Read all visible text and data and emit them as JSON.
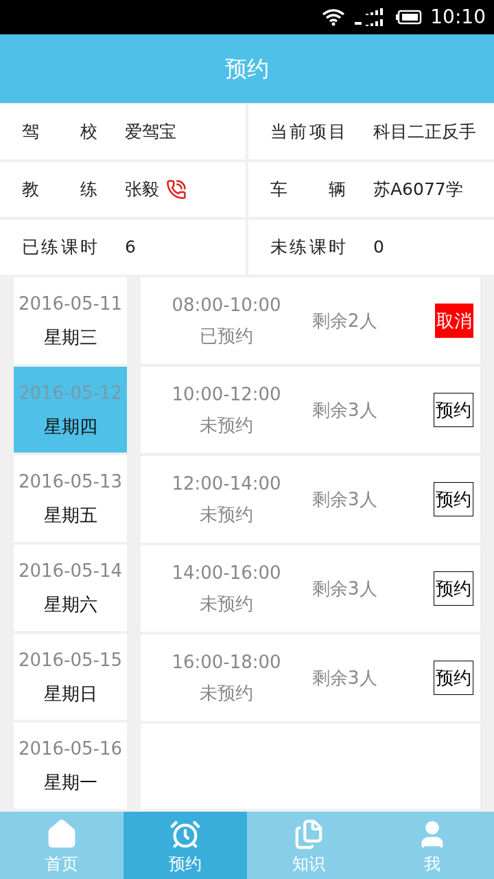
{
  "status_bar": {
    "time": "10:10"
  },
  "header": {
    "title": "预约"
  },
  "info": [
    {
      "label": "驾 校",
      "value": "爱驾宝",
      "phone": false
    },
    {
      "label": "当前项目",
      "value": "科目二正反手",
      "phone": false
    },
    {
      "label": "教 练",
      "value": "张毅",
      "phone": true
    },
    {
      "label": "车 辆",
      "value": "苏A6077学",
      "phone": false
    },
    {
      "label": "已练课时",
      "value": "6",
      "phone": false
    },
    {
      "label": "未练课时",
      "value": "0",
      "phone": false
    }
  ],
  "dates": [
    {
      "date": "2016-05-11",
      "weekday": "星期三",
      "selected": false
    },
    {
      "date": "2016-05-12",
      "weekday": "星期四",
      "selected": true
    },
    {
      "date": "2016-05-13",
      "weekday": "星期五",
      "selected": false
    },
    {
      "date": "2016-05-14",
      "weekday": "星期六",
      "selected": false
    },
    {
      "date": "2016-05-15",
      "weekday": "星期日",
      "selected": false
    },
    {
      "date": "2016-05-16",
      "weekday": "星期一",
      "selected": false
    }
  ],
  "slots": [
    {
      "time": "08:00-10:00",
      "status": "已预约",
      "remaining": "剩余2人",
      "kind": "cancel",
      "action": "取消"
    },
    {
      "time": "10:00-12:00",
      "status": "未预约",
      "remaining": "剩余3人",
      "kind": "book",
      "action": "预约"
    },
    {
      "time": "12:00-14:00",
      "status": "未预约",
      "remaining": "剩余3人",
      "kind": "book",
      "action": "预约"
    },
    {
      "time": "14:00-16:00",
      "status": "未预约",
      "remaining": "剩余3人",
      "kind": "book",
      "action": "预约"
    },
    {
      "time": "16:00-18:00",
      "status": "未预约",
      "remaining": "剩余3人",
      "kind": "book",
      "action": "预约"
    }
  ],
  "tabs": [
    {
      "label": "首页",
      "kind": "home",
      "selected": false
    },
    {
      "label": "预约",
      "kind": "alarm",
      "selected": true
    },
    {
      "label": "知识",
      "kind": "document",
      "selected": false
    },
    {
      "label": "我",
      "kind": "person",
      "selected": false
    }
  ]
}
